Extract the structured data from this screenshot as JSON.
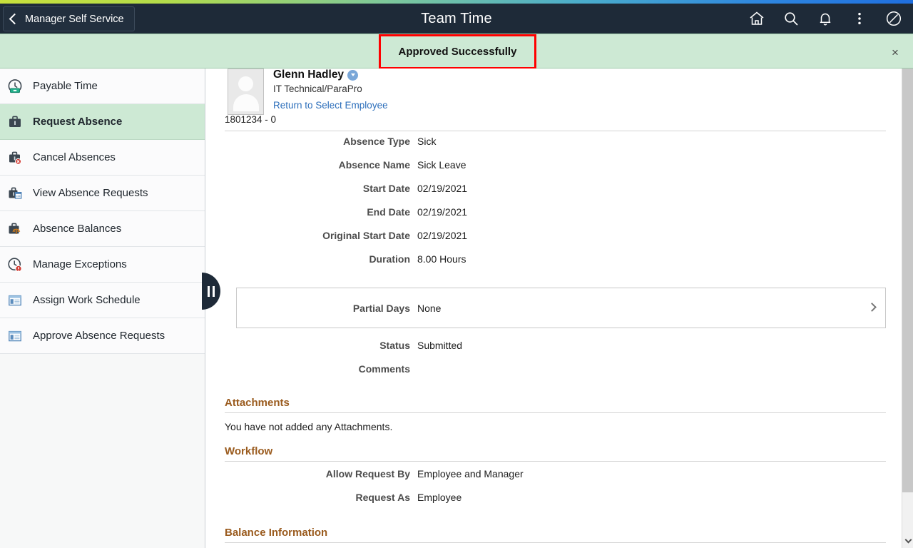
{
  "top_bar": {
    "gradient_start": "#c8e03c",
    "gradient_end": "#1f6fe0"
  },
  "header": {
    "back_label": "Manager Self Service",
    "title": "Team Time",
    "background": "#1e2a38",
    "icons": [
      {
        "name": "home-icon",
        "label": "Home"
      },
      {
        "name": "search-icon",
        "label": "Search"
      },
      {
        "name": "notifications-bell-icon",
        "label": "Notifications"
      },
      {
        "name": "actions-kebab-icon",
        "label": "Actions"
      },
      {
        "name": "navbar-compass-icon",
        "label": "NavBar"
      }
    ]
  },
  "message_banner": {
    "text": "Approved Successfully",
    "background": "#cde9d4",
    "highlight_color": "#ff0000",
    "close_label": "×"
  },
  "sidebar": {
    "items": [
      {
        "label": "Payable Time",
        "icon": "clock-payable-icon",
        "active": false
      },
      {
        "label": "Request Absence",
        "icon": "briefcase-icon",
        "active": true
      },
      {
        "label": "Cancel Absences",
        "icon": "briefcase-cancel-icon",
        "active": false
      },
      {
        "label": "View Absence Requests",
        "icon": "briefcase-calendar-icon",
        "active": false
      },
      {
        "label": "Absence Balances",
        "icon": "briefcase-scales-icon",
        "active": false
      },
      {
        "label": "Manage Exceptions",
        "icon": "clock-alert-icon",
        "active": false
      },
      {
        "label": "Assign Work Schedule",
        "icon": "window-panel-icon",
        "active": false
      },
      {
        "label": "Approve Absence Requests",
        "icon": "window-panel-icon",
        "active": false
      }
    ],
    "collapse_handle": "sidebar-collapse-handle"
  },
  "employee": {
    "name": "Glenn Hadley",
    "job_title": "IT Technical/ParaPro",
    "return_link": "Return to Select Employee",
    "employee_id": "1801234 - 0"
  },
  "absence_details": {
    "fields": [
      {
        "label": "Absence Type",
        "value": "Sick"
      },
      {
        "label": "Absence Name",
        "value": "Sick Leave"
      },
      {
        "label": "Start Date",
        "value": "02/19/2021"
      },
      {
        "label": "End Date",
        "value": "02/19/2021"
      },
      {
        "label": "Original Start Date",
        "value": "02/19/2021"
      },
      {
        "label": "Duration",
        "value": "8.00 Hours"
      }
    ],
    "partial_days": {
      "label": "Partial Days",
      "value": "None"
    },
    "status": {
      "label": "Status",
      "value": "Submitted"
    },
    "comments": {
      "label": "Comments",
      "value": ""
    }
  },
  "attachments": {
    "title": "Attachments",
    "empty_message": "You have not added any Attachments."
  },
  "workflow": {
    "title": "Workflow",
    "fields": [
      {
        "label": "Allow Request By",
        "value": "Employee and Manager"
      },
      {
        "label": "Request As",
        "value": "Employee"
      }
    ]
  },
  "balance_information": {
    "title": "Balance Information"
  }
}
